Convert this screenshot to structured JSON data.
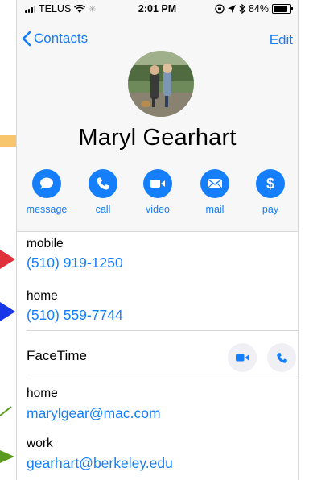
{
  "status_bar": {
    "carrier": "TELUS",
    "time": "2:01 PM",
    "battery": "84%"
  },
  "nav": {
    "back_label": "Contacts",
    "edit_label": "Edit"
  },
  "contact": {
    "name": "Maryl Gearhart"
  },
  "actions": [
    {
      "label": "message",
      "icon": "message-icon"
    },
    {
      "label": "call",
      "icon": "phone-icon"
    },
    {
      "label": "video",
      "icon": "video-icon"
    },
    {
      "label": "mail",
      "icon": "mail-icon"
    },
    {
      "label": "pay",
      "icon": "dollar-icon"
    }
  ],
  "phones": [
    {
      "label": "mobile",
      "value": "(510) 919-1250"
    },
    {
      "label": "home",
      "value": "(510) 559-7744"
    }
  ],
  "facetime": {
    "label": "FaceTime"
  },
  "emails": [
    {
      "label": "home",
      "value": "marylgear@mac.com"
    },
    {
      "label": "work",
      "value": "gearhart@berkeley.edu"
    }
  ],
  "colors": {
    "accent": "#147efb",
    "arrow_yellow": "#f9c56c",
    "arrow_red": "#e0303a",
    "arrow_blue": "#1636e8",
    "arrow_green": "#5a9a1e"
  }
}
